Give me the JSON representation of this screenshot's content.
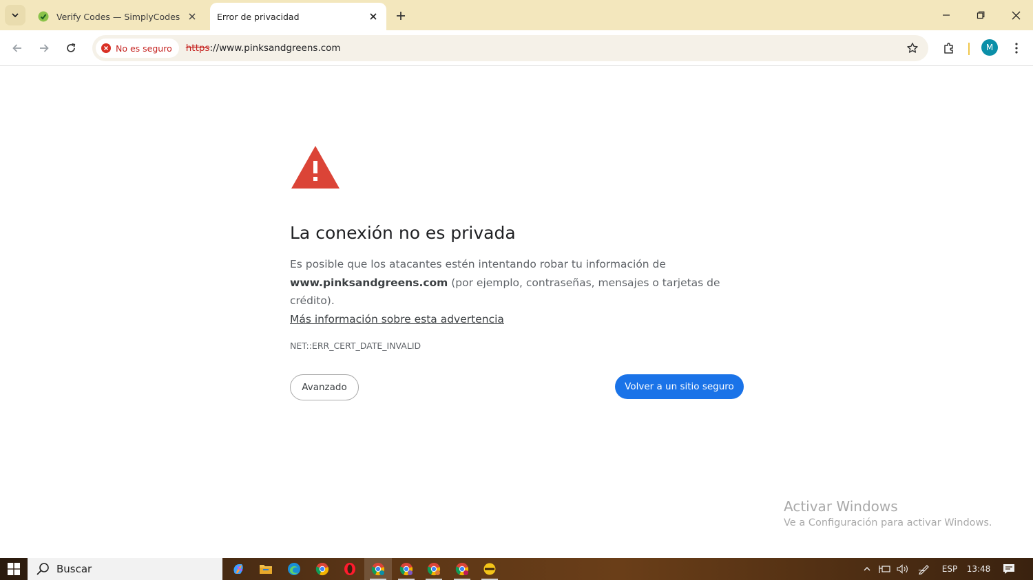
{
  "tabs": [
    {
      "title": "Verify Codes — SimplyCodes",
      "active": false
    },
    {
      "title": "Error de privacidad",
      "active": true
    }
  ],
  "omnibox": {
    "security_chip": "No es seguro",
    "url_scheme": "https",
    "url_rest": "://www.pinksandgreens.com"
  },
  "profile": {
    "initial": "M"
  },
  "page": {
    "heading": "La conexión no es privada",
    "desc_part1": "Es posible que los atacantes estén intentando robar tu información de",
    "domain": "www.pinksandgreens.com",
    "desc_part2": " (por ejemplo, contraseñas, mensajes o tarjetas de crédito).",
    "learn_more": "Más información sobre esta advertencia",
    "error_code": "NET::ERR_CERT_DATE_INVALID",
    "advanced_button": "Avanzado",
    "back_button": "Volver a un sitio seguro"
  },
  "watermark": {
    "title": "Activar Windows",
    "subtitle": "Ve a Configuración para activar Windows."
  },
  "taskbar": {
    "search_text": "Buscar",
    "language": "ESP",
    "time": "13:48"
  },
  "colors": {
    "tabstrip": "#f3e7bd",
    "danger": "#d93025",
    "primary_button": "#1a73e8"
  }
}
